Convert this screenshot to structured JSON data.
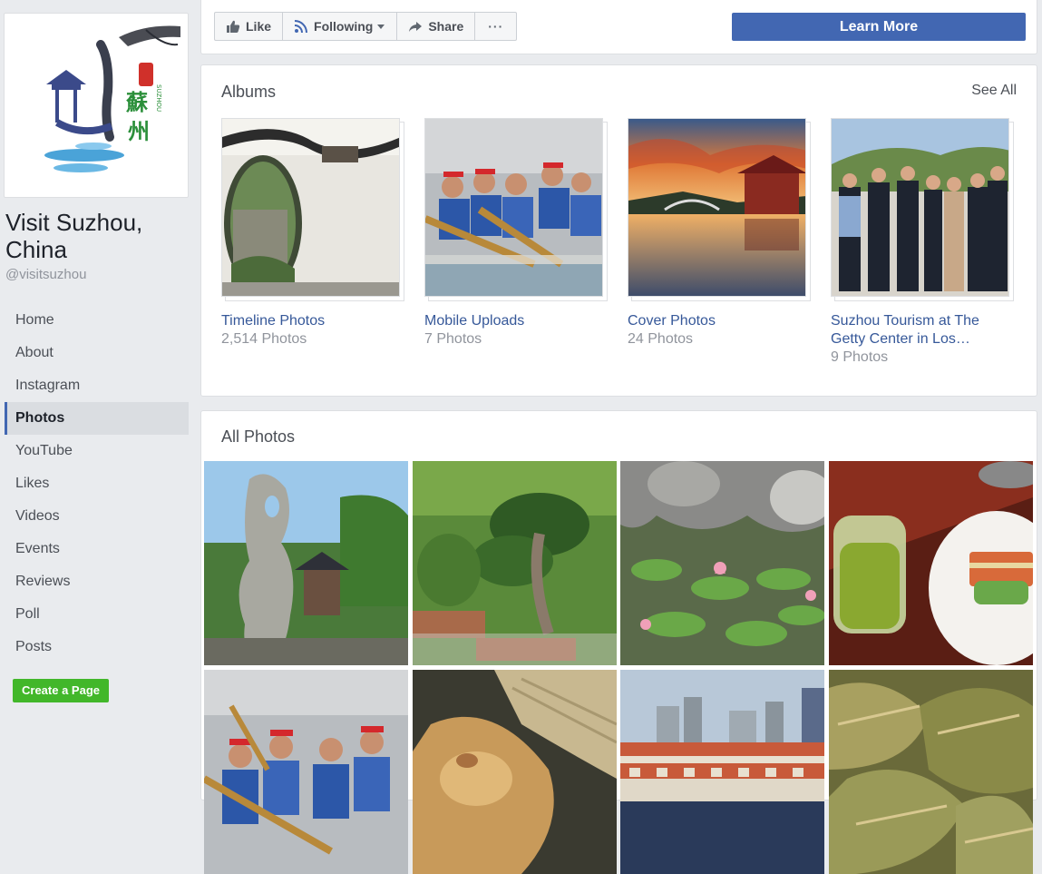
{
  "page": {
    "name": "Visit Suzhou, China",
    "handle": "@visitsuzhou"
  },
  "logo": {
    "lettering": "苏州 SUZHOU"
  },
  "nav": {
    "items": [
      {
        "label": "Home"
      },
      {
        "label": "About"
      },
      {
        "label": "Instagram"
      },
      {
        "label": "Photos",
        "active": true
      },
      {
        "label": "YouTube"
      },
      {
        "label": "Likes"
      },
      {
        "label": "Videos"
      },
      {
        "label": "Events"
      },
      {
        "label": "Reviews"
      },
      {
        "label": "Poll"
      },
      {
        "label": "Posts"
      }
    ],
    "create_page_label": "Create a Page"
  },
  "actions": {
    "like": "Like",
    "following": "Following",
    "share": "Share",
    "more": "···",
    "cta": "Learn More"
  },
  "albums": {
    "title": "Albums",
    "see_all": "See All",
    "items": [
      {
        "title": "Timeline Photos",
        "count": "2,514 Photos",
        "image": "garden moon gate"
      },
      {
        "title": "Mobile Uploads",
        "count": "7 Photos",
        "image": "dragon boat rowers"
      },
      {
        "title": "Cover Photos",
        "count": "24 Photos",
        "image": "pavilion at sunset"
      },
      {
        "title": "Suzhou Tourism at The Getty Center in Los…",
        "count": "9 Photos",
        "image": "group photo"
      }
    ]
  },
  "all_photos": {
    "title": "All Photos",
    "items": [
      {
        "image": "taihu rock and pavilion"
      },
      {
        "image": "bonsai garden"
      },
      {
        "image": "lotus pond"
      },
      {
        "image": "green tea and pastry"
      },
      {
        "image": "dragon boat rowers"
      },
      {
        "image": "zongzi rice dumpling"
      },
      {
        "image": "waterfront buildings"
      },
      {
        "image": "zongzi dumplings"
      }
    ]
  },
  "colors": {
    "link": "#365899",
    "accent": "#4267b2",
    "create_page": "#42b72a",
    "background": "#e9ebee"
  }
}
